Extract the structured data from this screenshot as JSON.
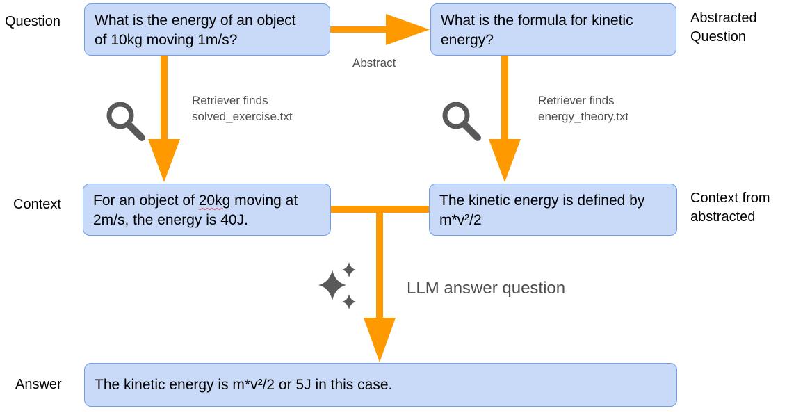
{
  "labels": {
    "question": "Question",
    "abstracted_line1": "Abstracted",
    "abstracted_line2": "Question",
    "context": "Context",
    "context_from_line1": "Context from",
    "context_from_line2": "abstracted",
    "answer": "Answer"
  },
  "boxes": {
    "question": {
      "line1": "What is the energy of an object",
      "line2": "of 10kg moving 1m/s?"
    },
    "abstracted_question": {
      "line1": "What is the formula for kinetic",
      "line2": "energy?"
    },
    "context": {
      "line1_before": "For an object of ",
      "line1_marked": "20kg",
      "line1_after": " moving at",
      "line2": "2m/s, the energy is 40J."
    },
    "context_abstracted": {
      "line1": "The kinetic energy is defined by",
      "line2": "m*v²/2"
    },
    "answer": {
      "text": "The kinetic energy is m*v²/2 or 5J in this case."
    }
  },
  "arrows": {
    "abstract_label": "Abstract",
    "retriever_left_line1": "Retriever finds",
    "retriever_left_line2": "solved_exercise.txt",
    "retriever_right_line1": "Retriever finds",
    "retriever_right_line2": "energy_theory.txt",
    "llm_label": "LLM answer question"
  },
  "icons": {
    "left_retriever": "magnifier-icon",
    "right_retriever": "magnifier-icon",
    "llm": "sparkle-icon"
  },
  "colors": {
    "box_fill": "#c9daf8",
    "box_border": "#6d9eeb",
    "arrow": "#ff9900",
    "icon": "#595959",
    "note_text": "#4d4d4d"
  }
}
